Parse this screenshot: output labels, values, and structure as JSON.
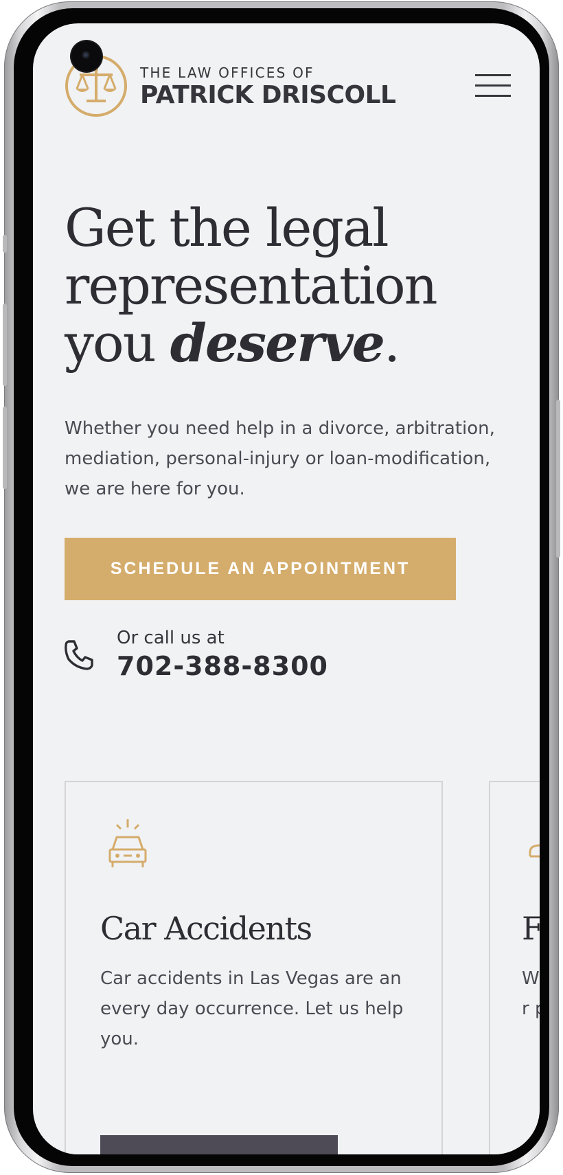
{
  "brand": {
    "prefix": "THE LAW OFFICES OF",
    "name": "PATRICK DRISCOLL",
    "accent": "#d4ac6b"
  },
  "nav": {
    "menu_icon": "hamburger-icon"
  },
  "hero": {
    "title_line1": "Get the legal",
    "title_line2": "representation",
    "title_you": "you ",
    "title_emph": "deserve",
    "title_end": ".",
    "subtitle": "Whether you need help in a divorce, arbitration, mediation, personal-injury or loan-modification, we are here for you.",
    "cta_label": "SCHEDULE AN APPOINTMENT",
    "call_label": "Or call us at",
    "call_number": "702-388-8300"
  },
  "practice_cards": [
    {
      "icon": "car-icon",
      "title": "Car Accidents",
      "text": "Car accidents in Las Vegas are an every day occurrence. Let us help you."
    },
    {
      "icon": "person-icon",
      "title": "F",
      "text": "W un co fir pr"
    }
  ]
}
